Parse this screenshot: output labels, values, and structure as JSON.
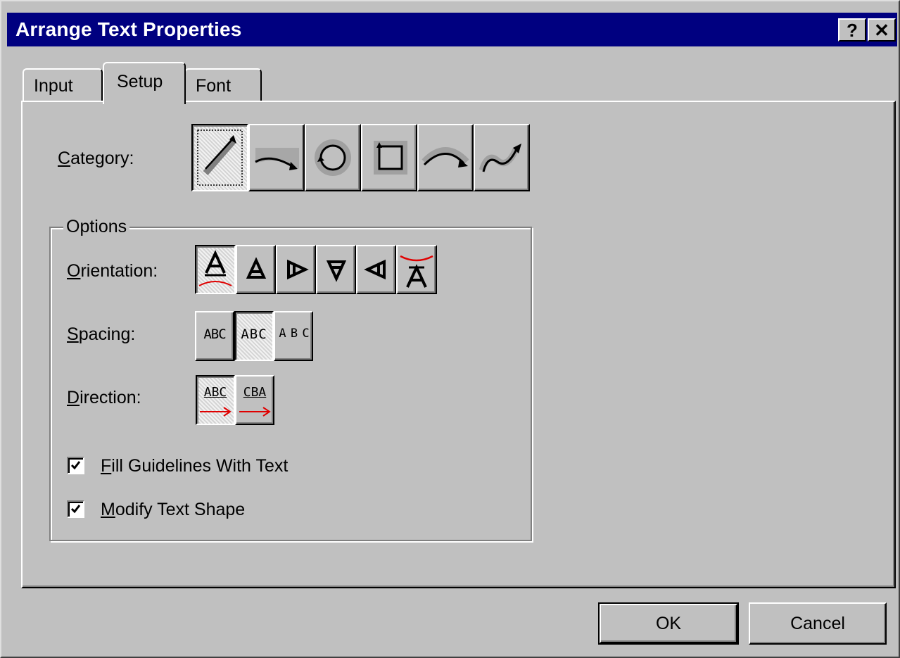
{
  "window": {
    "title": "Arrange Text Properties",
    "help_label": "?",
    "close_label": "✕"
  },
  "tabs": [
    {
      "label": "Input",
      "selected": false
    },
    {
      "label": "Setup",
      "selected": true
    },
    {
      "label": "Font",
      "selected": false
    }
  ],
  "category": {
    "label_first": "C",
    "label_rest": "ategory:",
    "options": [
      "straight-line",
      "straight-to-curve",
      "circle",
      "square",
      "arc",
      "s-curve"
    ],
    "selected": "straight-line"
  },
  "options_group": {
    "title": "Options",
    "orientation": {
      "label_first": "O",
      "label_rest": "rientation:",
      "selected": 0,
      "count": 6
    },
    "spacing": {
      "label_first": "S",
      "label_rest": "pacing:",
      "samples": [
        "ABC",
        "ABC",
        "A B C"
      ],
      "selected": 1
    },
    "direction": {
      "label_first": "D",
      "label_rest": "irection:",
      "samples": [
        "ABC",
        "CBA"
      ],
      "selected": 0
    },
    "fill_guidelines": {
      "label_first": "F",
      "label_rest": "ill Guidelines With Text",
      "checked": true
    },
    "modify_shape": {
      "label_first": "M",
      "label_rest": "odify Text Shape",
      "checked": true
    }
  },
  "buttons": {
    "ok": "OK",
    "cancel": "Cancel"
  },
  "colors": {
    "face": "#c0c0c0",
    "titlebar": "#000080",
    "accent_red": "#ff0000"
  }
}
